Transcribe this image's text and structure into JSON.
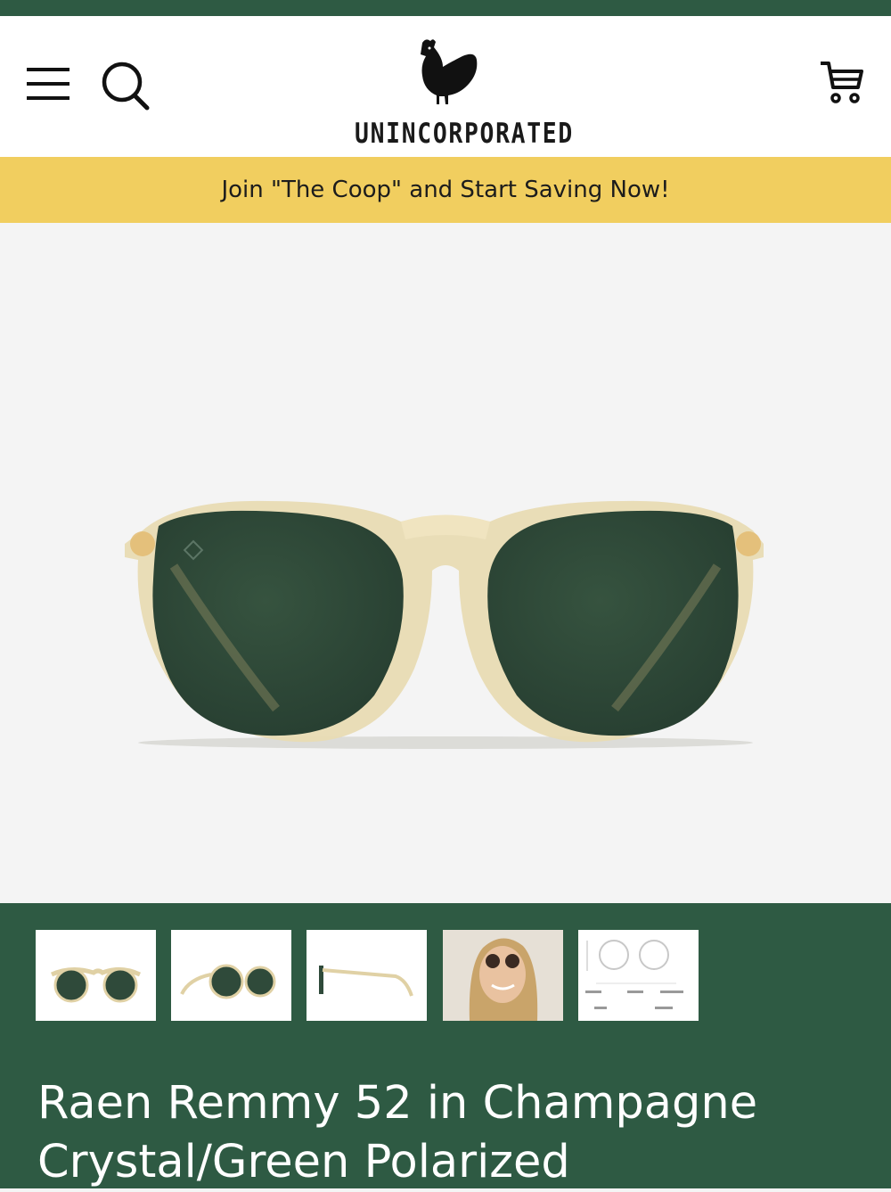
{
  "header": {
    "menu_icon": "hamburger-menu-icon",
    "search_icon": "search-icon",
    "cart_icon": "cart-icon",
    "logo_text": "UNINCORPORATED"
  },
  "promo": {
    "text": "Join \"The Coop\" and Start Saving Now!"
  },
  "product": {
    "title": "Raen Remmy 52 in Champagne Crystal/Green Polarized",
    "thumbnails": [
      {
        "view": "front"
      },
      {
        "view": "angle"
      },
      {
        "view": "side"
      },
      {
        "view": "model"
      },
      {
        "view": "measurements"
      }
    ]
  },
  "colors": {
    "brand_green": "#2e5a43",
    "promo_yellow": "#f1ce5f",
    "frame_champagne": "#e6d6a8",
    "lens_green": "#2f4a3a"
  }
}
